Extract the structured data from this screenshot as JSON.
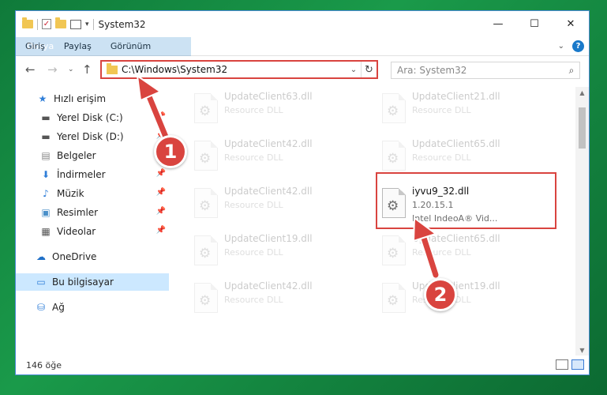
{
  "window": {
    "title": "System32",
    "controls": {
      "minimize": "—",
      "maximize": "☐",
      "close": "✕"
    }
  },
  "ribbon": {
    "tabs": [
      "Dosya",
      "Giriş",
      "Paylaş",
      "Görünüm"
    ]
  },
  "address": {
    "path": "C:\\Windows\\System32",
    "search_placeholder": "Ara: System32"
  },
  "sidebar": {
    "items": [
      {
        "label": "Hızlı erişim",
        "icon": "star-icon"
      },
      {
        "label": "Yerel Disk (C:)",
        "icon": "drive-icon",
        "pinned": true
      },
      {
        "label": "Yerel Disk (D:)",
        "icon": "drive-icon",
        "pinned": true
      },
      {
        "label": "Belgeler",
        "icon": "documents-icon",
        "pinned": true
      },
      {
        "label": "İndirmeler",
        "icon": "download-icon",
        "pinned": true
      },
      {
        "label": "Müzik",
        "icon": "music-icon",
        "pinned": true
      },
      {
        "label": "Resimler",
        "icon": "pictures-icon",
        "pinned": true
      },
      {
        "label": "Videolar",
        "icon": "videos-icon",
        "pinned": true
      },
      {
        "label": "OneDrive",
        "icon": "cloud-icon"
      },
      {
        "label": "Bu bilgisayar",
        "icon": "computer-icon",
        "selected": true
      },
      {
        "label": "Ağ",
        "icon": "network-icon"
      }
    ]
  },
  "files": [
    {
      "name": "UpdateClient63.dll",
      "sub": "Resource DLL",
      "active": false
    },
    {
      "name": "UpdateClient21.dll",
      "sub": "Resource DLL",
      "active": false
    },
    {
      "name": "UpdateClient42.dll",
      "sub": "Resource DLL",
      "active": false
    },
    {
      "name": "UpdateClient65.dll",
      "sub": "Resource DLL",
      "active": false
    },
    {
      "name": "UpdateClient42.dll",
      "sub": "Resource DLL",
      "active": false
    },
    {
      "name": "iyvu9_32.dll",
      "sub": "1.20.15.1",
      "sub2": "Intel IndeoA® Vid...",
      "active": true
    },
    {
      "name": "UpdateClient19.dll",
      "sub": "Resource DLL",
      "active": false
    },
    {
      "name": "UpdateClient65.dll",
      "sub": "Resource DLL",
      "active": false
    },
    {
      "name": "UpdateClient42.dll",
      "sub": "Resource DLL",
      "active": false
    },
    {
      "name": "UpdateClient19.dll",
      "sub": "Resource DLL",
      "active": false
    }
  ],
  "status": {
    "count": "146 öğe"
  },
  "annotations": {
    "step1": "1",
    "step2": "2",
    "color": "#d9443f"
  }
}
